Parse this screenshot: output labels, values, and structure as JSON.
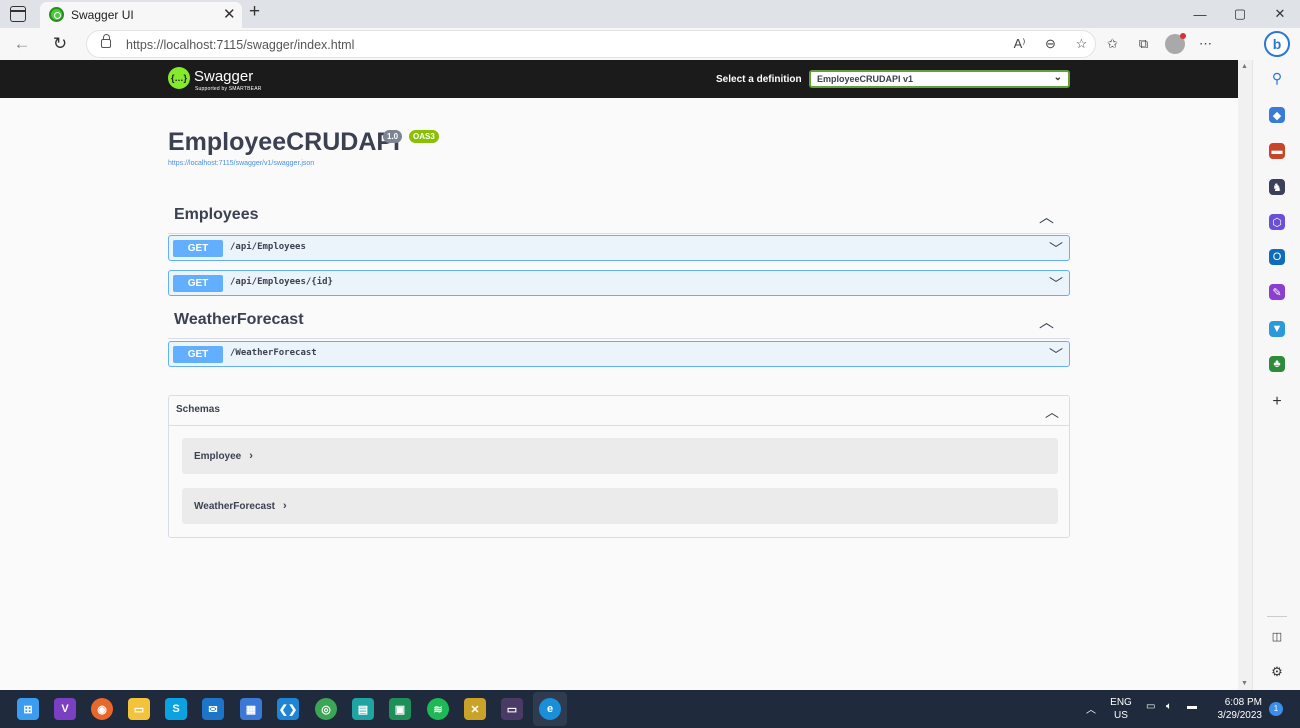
{
  "browser": {
    "tab_title": "Swagger UI",
    "url": "https://localhost:7115/swagger/index.html",
    "window_controls": [
      "—",
      "▢",
      "✕"
    ]
  },
  "swagger": {
    "logo_text": "Swagger",
    "logo_sub": "Supported by SMARTBEAR",
    "definition_label": "Select a definition",
    "definition_value": "EmployeeCRUDAPI v1",
    "api_title": "EmployeeCRUDAPI",
    "version_badge": "1.0",
    "oas_badge": "OAS3",
    "spec_link": "https://localhost:7115/swagger/v1/swagger.json",
    "sections": [
      {
        "title": "Employees",
        "operations": [
          {
            "method": "GET",
            "path": "/api/Employees"
          },
          {
            "method": "GET",
            "path": "/api/Employees/{id}"
          }
        ]
      },
      {
        "title": "WeatherForecast",
        "operations": [
          {
            "method": "GET",
            "path": "/WeatherForecast"
          }
        ]
      }
    ],
    "schemas_title": "Schemas",
    "schemas": [
      "Employee",
      "WeatherForecast"
    ]
  },
  "taskbar": {
    "language": "ENG",
    "region": "US",
    "time": "6:08 PM",
    "date": "3/29/2023",
    "notification_count": "1"
  },
  "colors": {
    "get_method": "#61affe",
    "get_bg": "#ebf3fb",
    "swagger_green": "#85ea2d",
    "topbar": "#1b1b1b"
  }
}
